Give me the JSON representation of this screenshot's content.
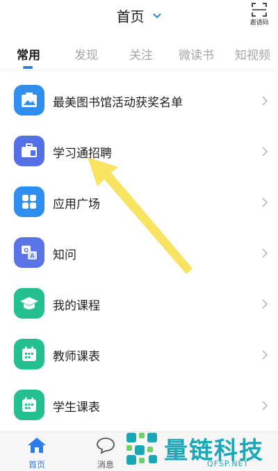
{
  "header": {
    "title": "首页",
    "invite_label": "邀请码"
  },
  "tabs": [
    {
      "label": "常用",
      "active": true
    },
    {
      "label": "发现",
      "active": false
    },
    {
      "label": "关注",
      "active": false
    },
    {
      "label": "微读书",
      "active": false
    },
    {
      "label": "知视频",
      "active": false
    }
  ],
  "list": [
    {
      "label": "最美图书馆活动获奖名单",
      "icon": "image-icon",
      "color": "#2e8ff0"
    },
    {
      "label": "学习通招聘",
      "icon": "briefcase-icon",
      "color": "#5470e8"
    },
    {
      "label": "应用广场",
      "icon": "apps-grid-icon",
      "color": "#2e8ff0"
    },
    {
      "label": "知问",
      "icon": "qa-icon",
      "color": "#5a74e8"
    },
    {
      "label": "我的课程",
      "icon": "graduation-cap-icon",
      "color": "#24c08f"
    },
    {
      "label": "教师课表",
      "icon": "calendar-icon",
      "color": "#24c08f"
    },
    {
      "label": "学生课表",
      "icon": "calendar-icon",
      "color": "#24c08f"
    }
  ],
  "bottom_nav": [
    {
      "label": "首页",
      "icon": "home-icon",
      "active": true
    },
    {
      "label": "消息",
      "icon": "chat-bubble-icon",
      "active": false
    }
  ],
  "watermark": {
    "text": "量链科技",
    "sub": "QFSP.NET"
  },
  "colors": {
    "accent": "#2b7de9",
    "arrow": "#f8e35a",
    "watermark": "#1aa7b7"
  }
}
